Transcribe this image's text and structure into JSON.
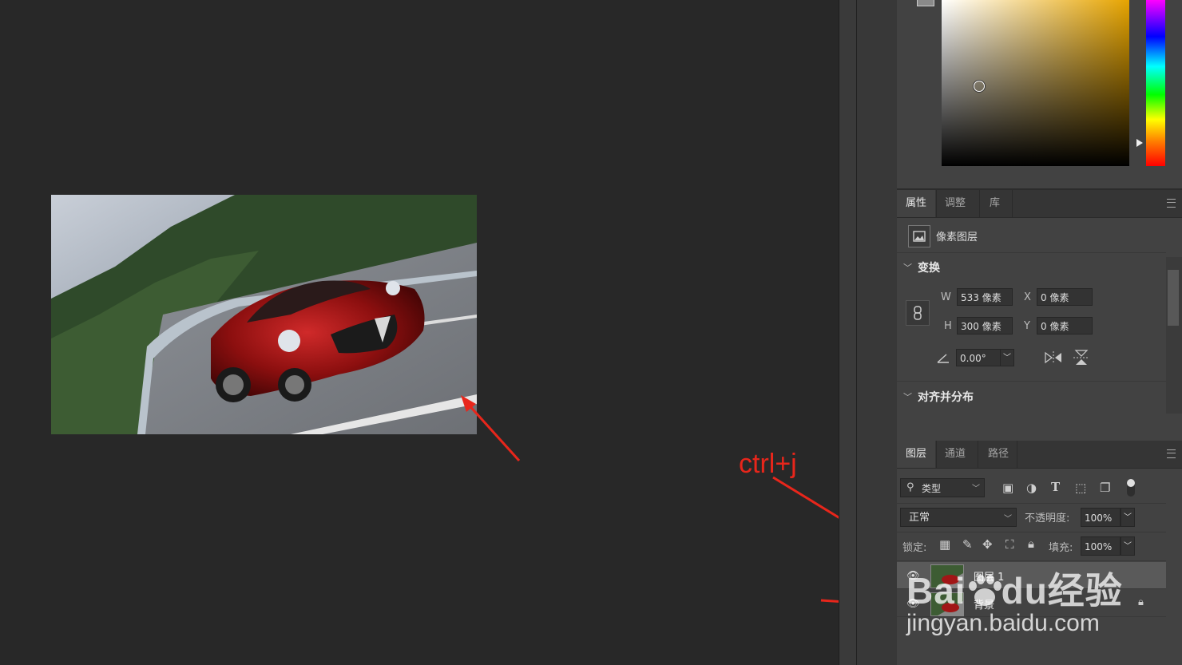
{
  "annotation": {
    "shortcut": "ctrl+j"
  },
  "colors": {
    "accent_red": "#e8261b",
    "hue_selected": "#e6a400",
    "panel_bg": "#424242",
    "canvas_bg": "#282828"
  },
  "properties_panel": {
    "tabs": [
      "属性",
      "调整",
      "库"
    ],
    "layer_type": "像素图层",
    "transform": {
      "title": "变换",
      "w_label": "W",
      "w_value": "533 像素",
      "h_label": "H",
      "h_value": "300 像素",
      "x_label": "X",
      "x_value": "0 像素",
      "y_label": "Y",
      "y_value": "0 像素",
      "angle_value": "0.00°"
    },
    "align": {
      "title": "对齐并分布"
    }
  },
  "layers_panel": {
    "tabs": [
      "图层",
      "通道",
      "路径"
    ],
    "filter": "类型",
    "blend_mode": "正常",
    "opacity_label": "不透明度:",
    "opacity_value": "100%",
    "lock_label": "锁定:",
    "fill_label": "填充:",
    "fill_value": "100%",
    "layers": [
      {
        "name": "图层 1",
        "selected": true,
        "locked": false
      },
      {
        "name": "背景",
        "selected": false,
        "locked": true
      }
    ]
  },
  "watermark": {
    "brand_left": "Bai",
    "brand_right": "du经验",
    "url": "jingyan.baidu.com"
  }
}
